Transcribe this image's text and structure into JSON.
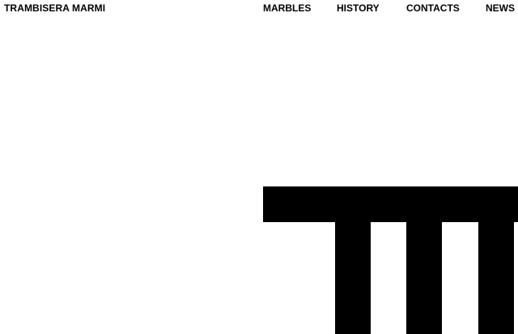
{
  "header": {
    "brand": "TRAMBISERA MARMI",
    "nav": [
      {
        "label": "MARBLES"
      },
      {
        "label": "HISTORY"
      },
      {
        "label": "CONTACTS"
      },
      {
        "label": "NEWS"
      }
    ]
  },
  "logo": {
    "icon": "trambisera-logo-mark",
    "color": "#000000"
  },
  "colors": {
    "background": "#ffffff",
    "text": "#000000"
  }
}
